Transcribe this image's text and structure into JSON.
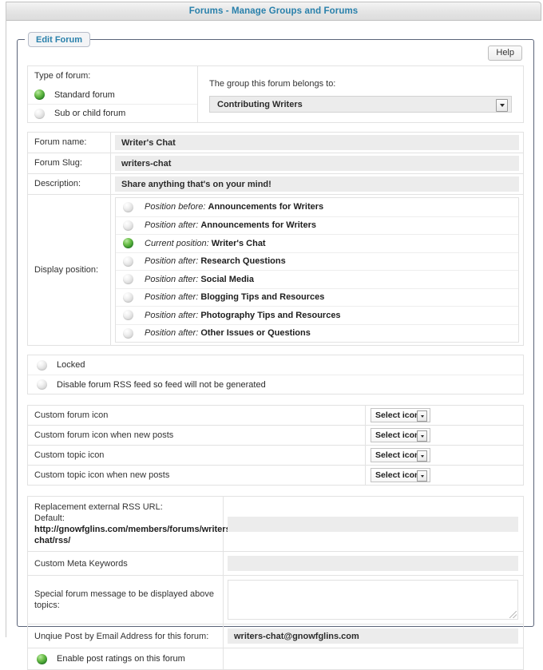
{
  "window": {
    "title": "Forums - Manage Groups and Forums"
  },
  "fieldset": {
    "legend": "Edit Forum",
    "help_label": "Help"
  },
  "type_of_forum": {
    "label": "Type of forum:",
    "options": [
      {
        "label": "Standard forum",
        "selected": true
      },
      {
        "label": "Sub or child forum",
        "selected": false
      }
    ]
  },
  "group": {
    "label": "The group this forum belongs to:",
    "selected": "Contributing Writers"
  },
  "fields": [
    {
      "label": "Forum name:",
      "value": "Writer's Chat"
    },
    {
      "label": "Forum Slug:",
      "value": "writers-chat"
    },
    {
      "label": "Description:",
      "value": "Share anything that's on your mind!"
    }
  ],
  "display_position": {
    "label": "Display position:",
    "items": [
      {
        "kind": "Position before:",
        "name": "Announcements for Writers",
        "selected": false
      },
      {
        "kind": "Position after:",
        "name": "Announcements for Writers",
        "selected": false
      },
      {
        "kind": "Current position:",
        "name": "Writer's Chat",
        "selected": true
      },
      {
        "kind": "Position after:",
        "name": "Research Questions",
        "selected": false
      },
      {
        "kind": "Position after:",
        "name": "Social Media",
        "selected": false
      },
      {
        "kind": "Position after:",
        "name": "Blogging Tips and Resources",
        "selected": false
      },
      {
        "kind": "Position after:",
        "name": "Photography Tips and Resources",
        "selected": false
      },
      {
        "kind": "Position after:",
        "name": "Other Issues or Questions",
        "selected": false
      }
    ]
  },
  "toggles": [
    {
      "label": "Locked",
      "selected": false
    },
    {
      "label": "Disable forum RSS feed so feed will not be generated",
      "selected": false
    }
  ],
  "icon_rows": [
    {
      "label": "Custom forum icon",
      "button": "Select icon"
    },
    {
      "label": "Custom forum icon when new posts",
      "button": "Select icon"
    },
    {
      "label": "Custom topic icon",
      "button": "Select icon"
    },
    {
      "label": "Custom topic icon when new posts",
      "button": "Select icon"
    }
  ],
  "bottom": {
    "rss": {
      "label_line1": "Replacement external RSS URL:",
      "label_line2_prefix": "Default: ",
      "label_url": "http://gnowfglins.com/members/forums/writers-chat/rss/",
      "value": ""
    },
    "meta_keywords": {
      "label": "Custom Meta Keywords",
      "value": ""
    },
    "special_message": {
      "label": "Special forum message to be displayed above topics:",
      "value": ""
    },
    "email_address": {
      "label": "Unqiue Post by Email Address for this forum:",
      "value": "writers-chat@gnowfglins.com"
    },
    "post_ratings": {
      "label": "Enable post ratings on this forum",
      "selected": true
    }
  },
  "colors": {
    "title_blue": "#2980ab",
    "orb_green": "#2e8b28",
    "fieldset_border": "#5a6379",
    "input_bg": "#ececec"
  }
}
